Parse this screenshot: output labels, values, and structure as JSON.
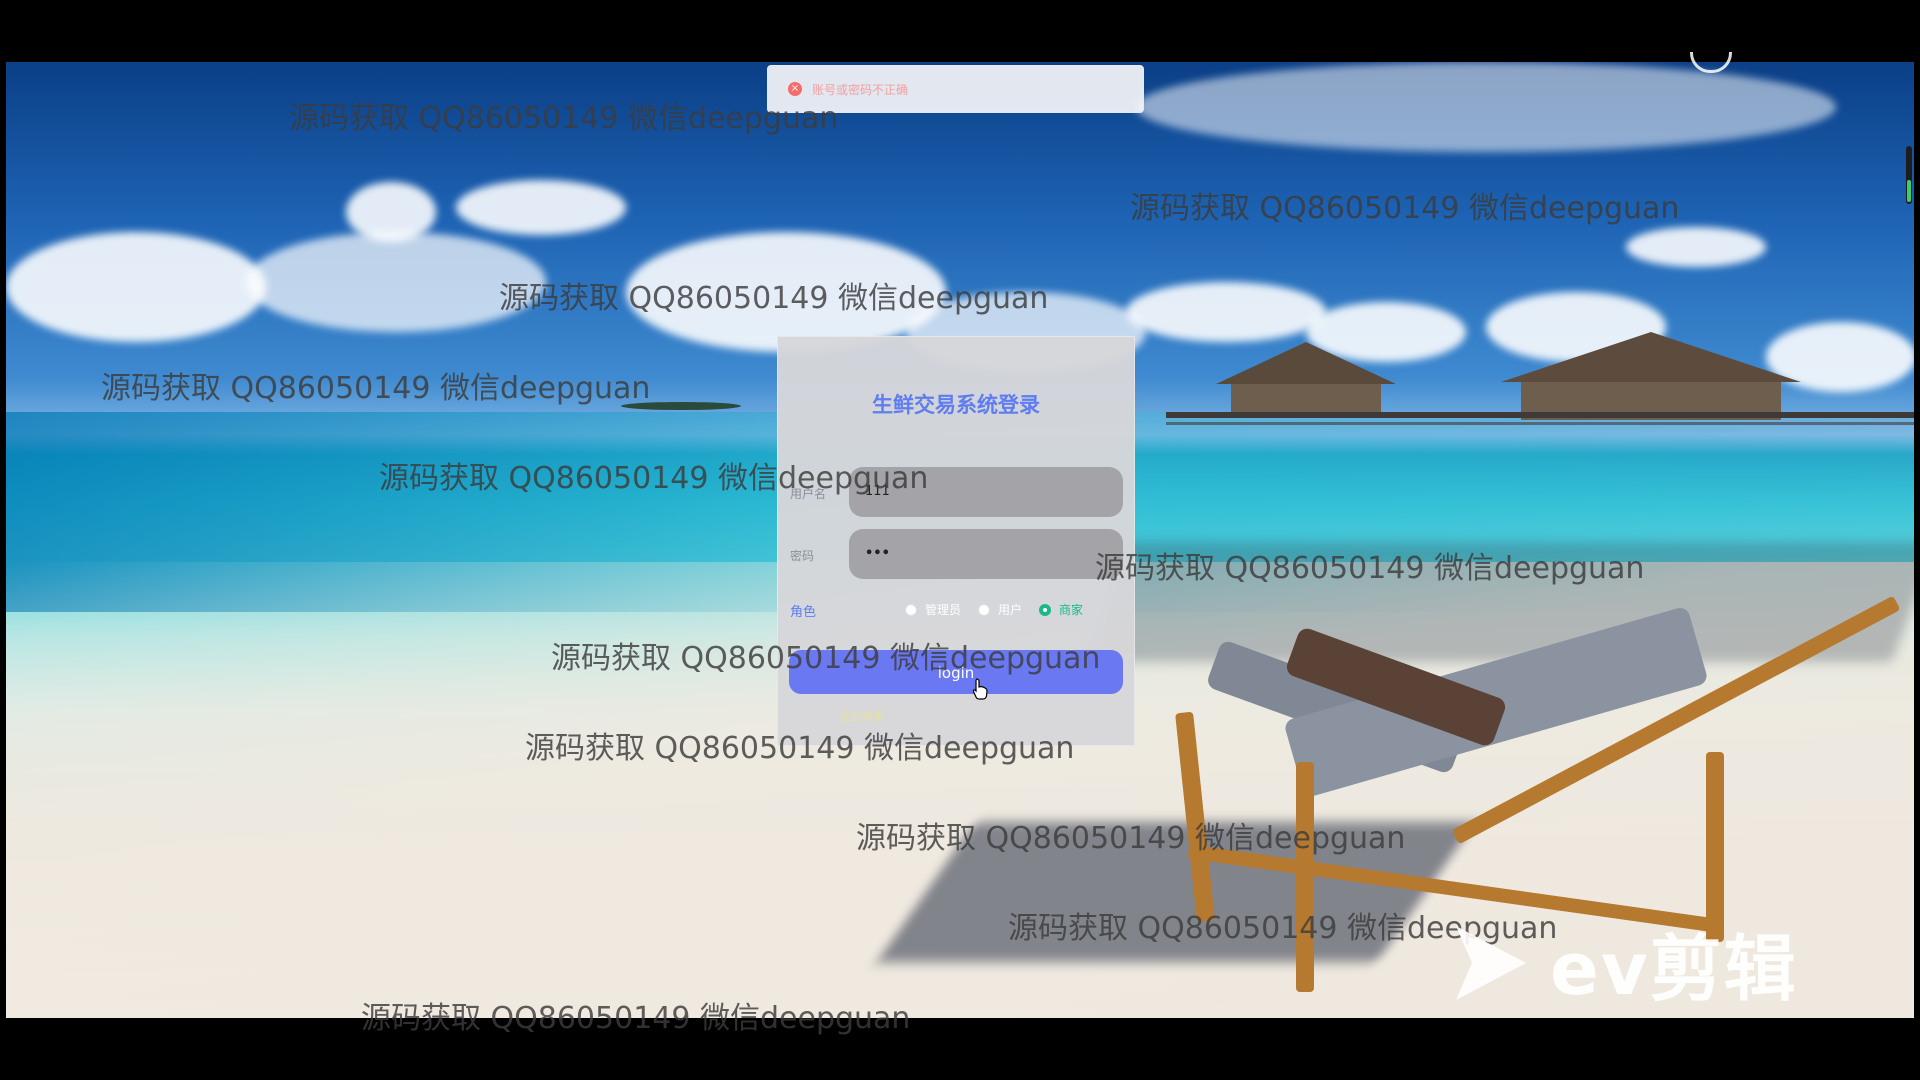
{
  "toast": {
    "icon": "error-circle-icon",
    "message": "账号或密码不正确"
  },
  "login": {
    "title": "生鲜交易系统登录",
    "username_label": "用户名",
    "username_value": "111",
    "password_label": "密码",
    "password_value": "•••",
    "role_label": "角色",
    "roles": [
      {
        "label": "管理员",
        "checked": false
      },
      {
        "label": "用户",
        "checked": false
      },
      {
        "label": "商家",
        "checked": true
      }
    ],
    "login_button": "login",
    "register_link": "注册商家"
  },
  "watermark_text": "源码获取 QQ86050149 微信deepguan",
  "logo": {
    "text": "ev剪辑",
    "icon": "play-triangle-icon"
  },
  "colors": {
    "accent": "#5f7df0",
    "button": "#6a78f2",
    "checked": "#19b98a",
    "error": "#f56c6c"
  }
}
